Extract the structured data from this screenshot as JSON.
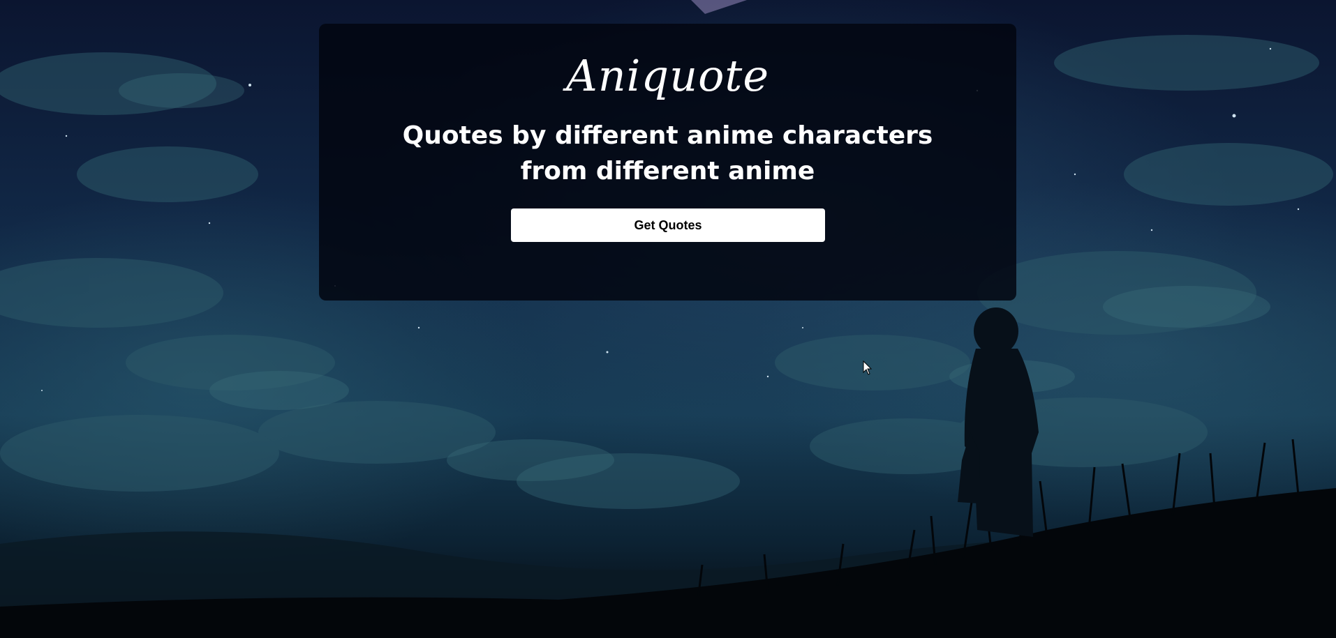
{
  "hero": {
    "logo": "Aniquote",
    "headline_line1": "Quotes by different anime characters",
    "headline_line2": "from different anime",
    "button_label": "Get Quotes"
  },
  "colors": {
    "card_background": "#02060f",
    "button_background": "#ffffff",
    "text": "#ffffff"
  },
  "icons": {
    "cursor": "mouse-pointer-icon"
  }
}
